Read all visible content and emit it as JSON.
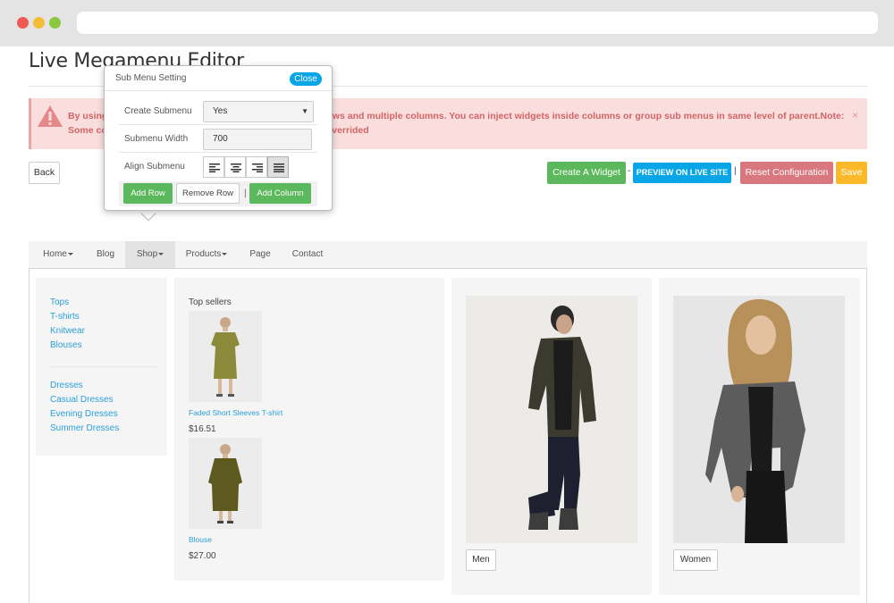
{
  "page": {
    "title": "Live Megamenu Editor"
  },
  "alert": {
    "text_line1": "By using                                                                                    ows and multiple columns. You can inject widgets inside columns or group sub menus in same level of parent.Note:",
    "text_line2": "Some co                                                                                    overrided",
    "close_label": "×",
    "icon": "warning-icon"
  },
  "toolbar": {
    "back_label": "Back",
    "create_widget_label": "Create A Widget",
    "dash": "-",
    "preview_label": "PREVIEW ON LIVE SITE",
    "pipe": "|",
    "reset_label": "Reset Configuration",
    "save_label": "Save"
  },
  "submenu_popup": {
    "title": "Sub Menu Setting",
    "close_label": "Close",
    "create_submenu_label": "Create Submenu",
    "create_submenu_value": "Yes",
    "submenu_width_label": "Submenu Width",
    "submenu_width_value": "700",
    "align_submenu_label": "Align Submenu",
    "align_options": [
      "align-left-icon",
      "align-center-icon",
      "align-right-icon",
      "align-justify-icon"
    ],
    "align_selected": "align-justify-icon",
    "add_row_label": "Add Row",
    "remove_row_label": "Remove Row",
    "separator": "|",
    "add_column_label": "Add Column"
  },
  "navbar": {
    "items": [
      {
        "label": "Home",
        "has_dropdown": true
      },
      {
        "label": "Blog",
        "has_dropdown": false
      },
      {
        "label": "Shop",
        "has_dropdown": true,
        "active": true
      },
      {
        "label": "Products",
        "has_dropdown": true
      },
      {
        "label": "Page",
        "has_dropdown": false
      },
      {
        "label": "Contact",
        "has_dropdown": false
      }
    ]
  },
  "megamenu": {
    "links_group1": [
      "Tops",
      "T-shirts",
      "Knitwear",
      "Blouses"
    ],
    "links_group2": [
      "Dresses",
      "Casual Dresses",
      "Evening Dresses",
      "Summer Dresses"
    ],
    "top_sellers": {
      "title": "Top sellers",
      "products": [
        {
          "name": "Faded Short Sleeves T-shirt",
          "price": "$16.51"
        },
        {
          "name": "Blouse",
          "price": "$27.00"
        }
      ]
    },
    "banners": [
      {
        "label": "Men"
      },
      {
        "label": "Women"
      }
    ]
  },
  "colors": {
    "green": "#5cb85c",
    "blue": "#08a6e6",
    "red": "#d9777f",
    "yellow": "#fbb92a",
    "link": "#2b9fd8",
    "alert_bg": "#fadede"
  }
}
